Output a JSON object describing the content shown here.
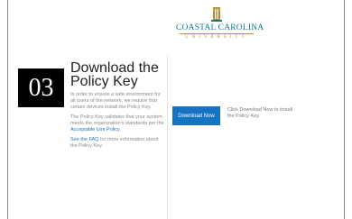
{
  "logo": {
    "name": "COASTAL CAROLINA",
    "sub": "UNIVERSITY",
    "icon": "chanticleer-logo-icon",
    "colors": {
      "teal": "#0e7b86",
      "gold": "#b88b2e"
    }
  },
  "step": {
    "number": "03"
  },
  "heading": "Download the Policy Key",
  "description": {
    "p1": "In order to ensure a safe environment for all users of the network, we require that certain devices install the Policy Key.",
    "p2_text": "The Policy Key validates that your system meets the organization's standards per the ",
    "p2_link": "Acceptable Use Policy",
    "p2_end": ".",
    "p3_link": "See the FAQ",
    "p3_text": " for more information about the Policy Key."
  },
  "actions": {
    "download_label": "Download Now",
    "instruction": "Click Download Now to install the Policy Key."
  },
  "colors": {
    "accent": "#1673c4",
    "step_bg": "#000000"
  }
}
